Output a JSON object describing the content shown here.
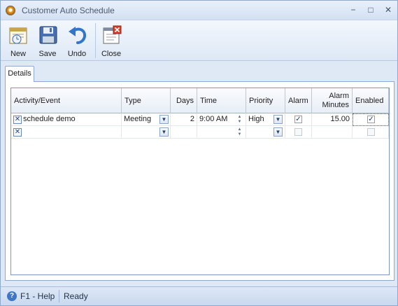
{
  "window": {
    "title": "Customer Auto Schedule",
    "controls": {
      "minimize": "−",
      "maximize": "□",
      "close": "✕"
    }
  },
  "toolbar": {
    "buttons": [
      {
        "label": "New",
        "icon": "new-schedule-icon"
      },
      {
        "label": "Save",
        "icon": "floppy-disk-icon"
      },
      {
        "label": "Undo",
        "icon": "undo-arrow-icon"
      },
      {
        "label": "Close",
        "icon": "close-window-icon"
      }
    ]
  },
  "tabs": [
    {
      "label": "Details"
    }
  ],
  "grid": {
    "columns": {
      "activity": "Activity/Event",
      "type": "Type",
      "days": "Days",
      "time": "Time",
      "priority": "Priority",
      "alarm": "Alarm",
      "alarm_minutes_1": "Alarm",
      "alarm_minutes_2": "Minutes",
      "enabled": "Enabled"
    },
    "rows": [
      {
        "activity": "schedule demo",
        "type": "Meeting",
        "days": "2",
        "time": "9:00 AM",
        "priority": "High",
        "alarm": true,
        "alarm_minutes": "15.00",
        "enabled": true
      },
      {
        "activity": "",
        "type": "",
        "days": "",
        "time": "",
        "priority": "",
        "alarm": false,
        "alarm_minutes": "",
        "enabled": false
      }
    ]
  },
  "statusbar": {
    "help": "F1 - Help",
    "status": "Ready"
  },
  "colors": {
    "accent": "#3f76c8",
    "window_bg": "#dfe9f6",
    "border": "#8fa9cc"
  }
}
